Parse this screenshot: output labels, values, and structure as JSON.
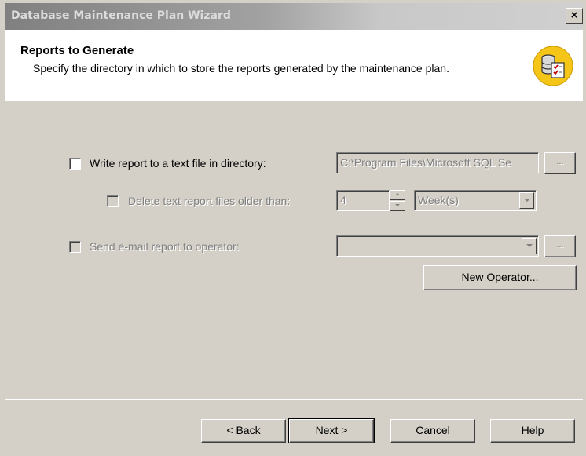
{
  "window": {
    "title": "Database Maintenance Plan Wizard",
    "close_glyph": "×"
  },
  "header": {
    "title": "Reports to Generate",
    "description": "Specify the directory in which to store the reports generated by the maintenance plan.",
    "icon": "database-report-icon"
  },
  "report_file": {
    "checkbox_label": "Write report to a text file in directory:",
    "checked": false,
    "directory_value": "C:\\Program Files\\Microsoft SQL Se",
    "browse_label": "..."
  },
  "delete_old": {
    "checkbox_label": "Delete text report files older than:",
    "checked": false,
    "enabled": false,
    "amount_value": "4",
    "unit_value": "Week(s)"
  },
  "email": {
    "checkbox_label": "Send e-mail report to operator:",
    "checked": false,
    "enabled": false,
    "operator_value": "",
    "browse_label": "...",
    "new_operator_label": "New Operator..."
  },
  "footer": {
    "back_label": "< Back",
    "next_label": "Next >",
    "cancel_label": "Cancel",
    "help_label": "Help"
  },
  "colors": {
    "dialog_bg": "#d4d0c8",
    "header_bg": "#ffffff",
    "icon_gold": "#f5c518"
  }
}
